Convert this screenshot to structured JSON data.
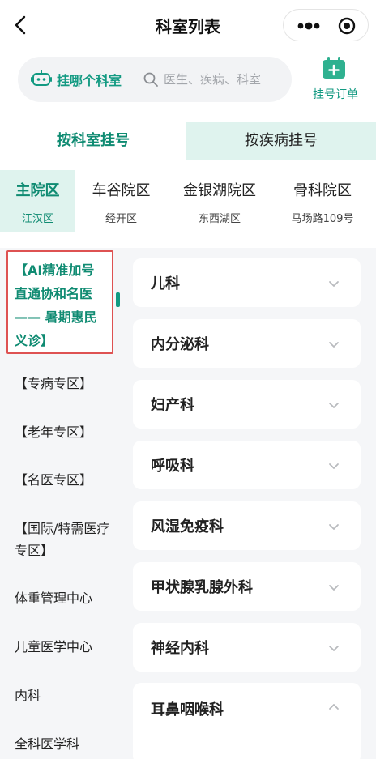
{
  "nav": {
    "title": "科室列表",
    "back_icon": "chevron-left-icon",
    "more_icon": "more-dots-icon",
    "target_icon": "target-circle-icon"
  },
  "search": {
    "robot_label": "挂哪个科室",
    "placeholder": "医生、疾病、科室",
    "value": ""
  },
  "order": {
    "label": "挂号订单",
    "icon": "calendar-plus-icon"
  },
  "tabs": [
    {
      "label": "按科室挂号",
      "active": true
    },
    {
      "label": "按疾病挂号",
      "active": false
    }
  ],
  "campuses": [
    {
      "name": "主院区",
      "sub": "江汉区",
      "active": true
    },
    {
      "name": "车谷院区",
      "sub": "经开区",
      "active": false
    },
    {
      "name": "金银湖院区",
      "sub": "东西湖区",
      "active": false
    },
    {
      "name": "骨科院区",
      "sub": "马场路109号",
      "active": false
    }
  ],
  "sidebar": {
    "active_label": "【AI精准加号直通协和名医—— 暑期惠民义诊】",
    "items": [
      "【专病专区】",
      "【老年专区】",
      "【名医专区】",
      "【国际/特需医疗专区】",
      "体重管理中心",
      "儿童医学中心",
      "内科",
      "全科医学科"
    ]
  },
  "departments": [
    {
      "name": "儿科",
      "expanded": false
    },
    {
      "name": "内分泌科",
      "expanded": false
    },
    {
      "name": "妇产科",
      "expanded": false
    },
    {
      "name": "呼吸科",
      "expanded": false
    },
    {
      "name": "风湿免疫科",
      "expanded": false
    },
    {
      "name": "甲状腺乳腺外科",
      "expanded": false
    },
    {
      "name": "神经内科",
      "expanded": false
    },
    {
      "name": "耳鼻咽喉科",
      "expanded": true
    }
  ],
  "colors": {
    "accent": "#139a82",
    "accent_dark": "#0f8b72",
    "accent_light": "#dff3ee",
    "highlight_border": "#de5252",
    "background": "#f5f6f8"
  }
}
